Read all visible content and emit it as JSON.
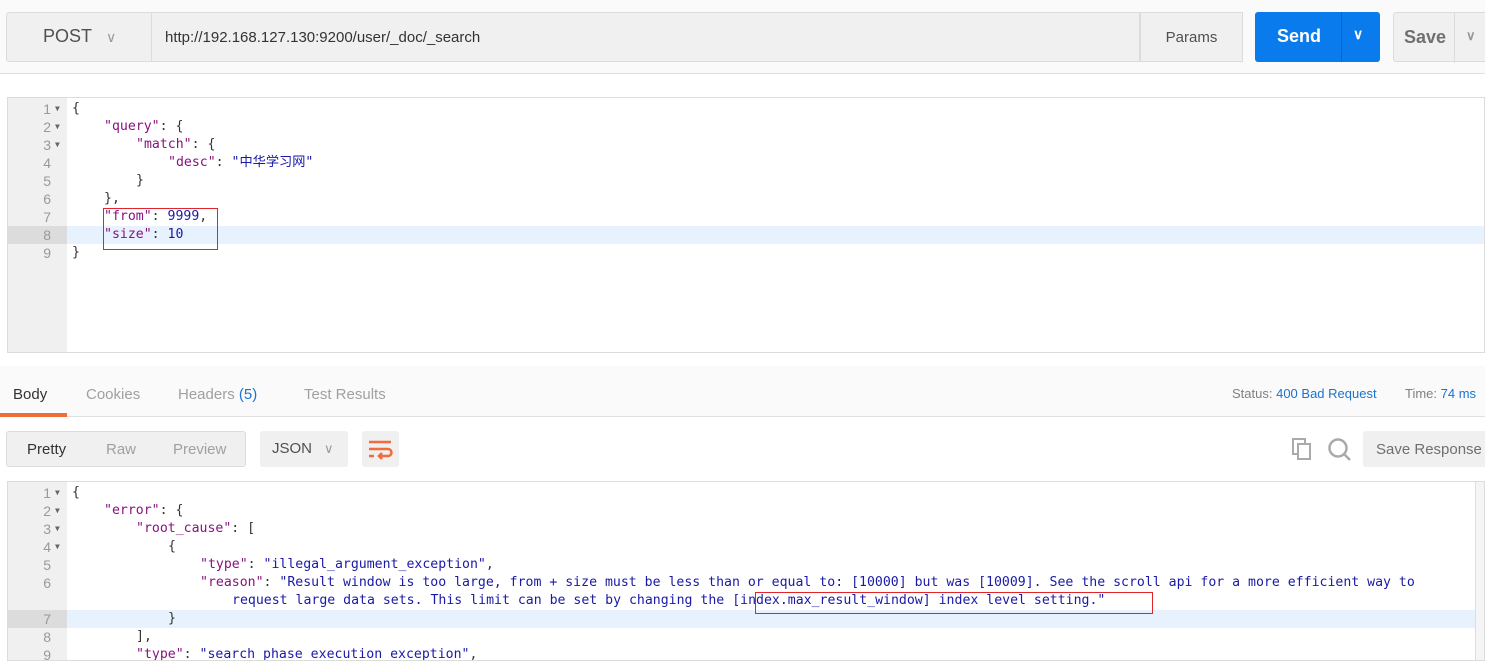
{
  "request": {
    "method": "POST",
    "url": "http://192.168.127.130:9200/user/_doc/_search",
    "params_label": "Params",
    "send_label": "Send",
    "save_label": "Save"
  },
  "request_body": [
    {
      "n": "1",
      "fold": true,
      "indent": 0,
      "parts": [
        [
          "p",
          "{"
        ]
      ]
    },
    {
      "n": "2",
      "fold": true,
      "indent": 1,
      "parts": [
        [
          "k",
          "\"query\""
        ],
        [
          "p",
          ": {"
        ]
      ]
    },
    {
      "n": "3",
      "fold": true,
      "indent": 2,
      "parts": [
        [
          "k",
          "\"match\""
        ],
        [
          "p",
          ": {"
        ]
      ]
    },
    {
      "n": "4",
      "fold": false,
      "indent": 3,
      "parts": [
        [
          "k",
          "\"desc\""
        ],
        [
          "p",
          ": "
        ],
        [
          "s",
          "\"中华学习网\""
        ]
      ]
    },
    {
      "n": "5",
      "fold": false,
      "indent": 2,
      "parts": [
        [
          "p",
          "}"
        ]
      ]
    },
    {
      "n": "6",
      "fold": false,
      "indent": 1,
      "parts": [
        [
          "p",
          "},"
        ]
      ]
    },
    {
      "n": "7",
      "fold": false,
      "indent": 1,
      "parts": [
        [
          "k",
          "\"from\""
        ],
        [
          "p",
          ": "
        ],
        [
          "n",
          "9999"
        ],
        [
          "p",
          ","
        ]
      ]
    },
    {
      "n": "8",
      "fold": false,
      "indent": 1,
      "hl": true,
      "parts": [
        [
          "k",
          "\"size\""
        ],
        [
          "p",
          ": "
        ],
        [
          "n",
          "10"
        ]
      ]
    },
    {
      "n": "9",
      "fold": false,
      "indent": 0,
      "parts": [
        [
          "p",
          "}"
        ]
      ]
    }
  ],
  "response_tabs": [
    {
      "label": "Body",
      "active": true
    },
    {
      "label": "Cookies"
    },
    {
      "label": "Headers",
      "count": "(5)"
    },
    {
      "label": "Test Results"
    }
  ],
  "status": {
    "status_label": "Status:",
    "status_value": "400 Bad Request",
    "time_label": "Time:",
    "time_value": "74 ms"
  },
  "view_modes": [
    "Pretty",
    "Raw",
    "Preview"
  ],
  "format": "JSON",
  "save_response_label": "Save Response",
  "icons": {
    "wrap": "wrap-lines-icon",
    "copy": "copy-icon",
    "search": "search-icon"
  },
  "colors": {
    "accent": "#f26b3a",
    "send": "#097bed",
    "highlight_box": "#e0262b"
  },
  "response_body": [
    {
      "n": "1",
      "fold": true,
      "indent": 0,
      "parts": [
        [
          "p",
          "{"
        ]
      ]
    },
    {
      "n": "2",
      "fold": true,
      "indent": 1,
      "parts": [
        [
          "k",
          "\"error\""
        ],
        [
          "p",
          ": {"
        ]
      ]
    },
    {
      "n": "3",
      "fold": true,
      "indent": 2,
      "parts": [
        [
          "k",
          "\"root_cause\""
        ],
        [
          "p",
          ": ["
        ]
      ]
    },
    {
      "n": "4",
      "fold": true,
      "indent": 3,
      "parts": [
        [
          "p",
          "{"
        ]
      ]
    },
    {
      "n": "5",
      "fold": false,
      "indent": 4,
      "parts": [
        [
          "k",
          "\"type\""
        ],
        [
          "p",
          ": "
        ],
        [
          "s",
          "\"illegal_argument_exception\""
        ],
        [
          "p",
          ","
        ]
      ]
    },
    {
      "n": "6",
      "fold": false,
      "indent": 4,
      "parts": [
        [
          "k",
          "\"reason\""
        ],
        [
          "p",
          ": "
        ],
        [
          "s",
          "\"Result window is too large, from + size must be less than or equal to: [10000] but was [10009]. See the scroll api for a more efficient way to"
        ]
      ]
    },
    {
      "n": "",
      "fold": false,
      "indent": 5,
      "parts": [
        [
          "s",
          "request large data sets. This limit can be set by changing the [index.max_result_window] index level setting.\""
        ]
      ]
    },
    {
      "n": "7",
      "fold": false,
      "indent": 3,
      "hl": true,
      "parts": [
        [
          "p",
          "}"
        ]
      ]
    },
    {
      "n": "8",
      "fold": false,
      "indent": 2,
      "parts": [
        [
          "p",
          "],"
        ]
      ]
    },
    {
      "n": "9",
      "fold": false,
      "indent": 2,
      "parts": [
        [
          "k",
          "\"type\""
        ],
        [
          "p",
          ": "
        ],
        [
          "s",
          "\"search_phase_execution_exception\""
        ],
        [
          "p",
          ","
        ]
      ]
    }
  ]
}
